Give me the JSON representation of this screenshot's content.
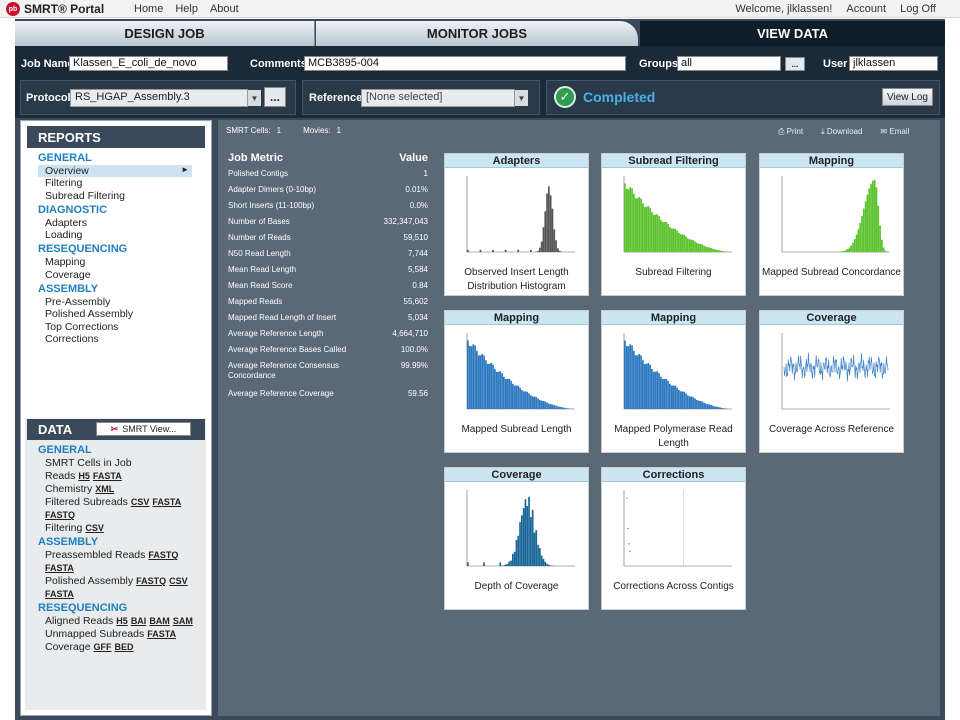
{
  "topbar": {
    "logo_mark": "pb",
    "logo_text": "SMRT® Portal",
    "nav": [
      "Home",
      "Help",
      "About"
    ],
    "welcome": "Welcome, jlklassen!",
    "account": "Account",
    "logoff": "Log Off"
  },
  "tabs": [
    "DESIGN JOB",
    "MONITOR JOBS",
    "VIEW DATA"
  ],
  "job": {
    "name_label": "Job Name",
    "name": "Klassen_E_coli_de_novo",
    "comments_label": "Comments",
    "comments": "MCB3895-004",
    "groups_label": "Groups",
    "groups": "all",
    "groups_btn": "...",
    "user_label": "User",
    "user": "jlklassen",
    "protocol_label": "Protocol",
    "protocol": "RS_HGAP_Assembly.3",
    "protocol_btn": "...",
    "reference_label": "Reference",
    "reference": "[None selected]",
    "status": "Completed",
    "view_log": "View Log"
  },
  "reports": {
    "title": "REPORTS",
    "general": "GENERAL",
    "general_items": [
      "Overview",
      "Filtering",
      "Subread Filtering"
    ],
    "diagnostic": "DIAGNOSTIC",
    "diagnostic_items": [
      "Adapters",
      "Loading"
    ],
    "resequencing": "RESEQUENCING",
    "resequencing_items": [
      "Mapping",
      "Coverage"
    ],
    "assembly": "ASSEMBLY",
    "assembly_items": [
      "Pre-Assembly",
      "Polished Assembly",
      "Top Corrections",
      "Corrections"
    ],
    "selected_marker": "►"
  },
  "data_panel": {
    "title": "DATA",
    "smrt_view": "SMRT View...",
    "general": "GENERAL",
    "cells": "SMRT Cells in Job",
    "reads": "Reads",
    "reads_h5": "H5",
    "reads_fasta": "FASTA",
    "chemistry": "Chemistry",
    "chem_xml": "XML",
    "filtered": "Filtered Subreads",
    "filt_csv": "CSV",
    "filt_fasta": "FASTA",
    "filt_fastq": "FASTQ",
    "filtering": "Filtering",
    "filtering_csv": "CSV",
    "assembly": "ASSEMBLY",
    "preassembled": "Preassembled Reads",
    "pre_fastq": "FASTQ",
    "pre_fasta": "FASTA",
    "polished": "Polished Assembly",
    "pol_fastq": "FASTQ",
    "pol_csv": "CSV",
    "pol_fasta": "FASTA",
    "resequencing": "RESEQUENCING",
    "aligned": "Aligned Reads",
    "al_h5": "H5",
    "al_bai": "BAI",
    "al_bam": "BAM",
    "al_sam": "SAM",
    "unmapped": "Unmapped Subreads",
    "un_fasta": "FASTA",
    "coverage": "Coverage",
    "cov_gff": "GFF",
    "cov_bed": "BED"
  },
  "summary": {
    "cells_label": "SMRT Cells:",
    "cells": "1",
    "movies_label": "Movies:",
    "movies": "1",
    "print": "Print",
    "download": "Download",
    "email": "Email"
  },
  "metrics": {
    "head_metric": "Job Metric",
    "head_value": "Value",
    "rows": [
      {
        "label": "Polished Contigs",
        "value": "1"
      },
      {
        "label": "Adapter Dimers (0-10bp)",
        "value": "0.01%"
      },
      {
        "label": "Short Inserts (11-100bp)",
        "value": "0.0%"
      },
      {
        "label": "Number of Bases",
        "value": "332,347,043"
      },
      {
        "label": "Number of Reads",
        "value": "59,510"
      },
      {
        "label": "N50 Read Length",
        "value": "7,744"
      },
      {
        "label": "Mean Read Length",
        "value": "5,584"
      },
      {
        "label": "Mean Read Score",
        "value": "0.84"
      },
      {
        "label": "Mapped Reads",
        "value": "55,602"
      },
      {
        "label": "Mapped Read Length of Insert",
        "value": "5,034"
      },
      {
        "label": "Average Reference Length",
        "value": "4,664,710"
      },
      {
        "label": "Average Reference Bases Called",
        "value": "100.0%"
      },
      {
        "label": "Average Reference Consensus Concordance",
        "value": "99.99%"
      },
      {
        "label": "Average Reference Coverage",
        "value": "59.56"
      }
    ]
  },
  "cards": [
    {
      "title": "Adapters",
      "caption": "Observed Insert Length Distribution Histogram",
      "color": "#555555",
      "shape": "spike"
    },
    {
      "title": "Subread Filtering",
      "caption": "Subread Filtering",
      "color": "#5cc22e",
      "shape": "decay"
    },
    {
      "title": "Mapping",
      "caption": "Mapped Subread Concordance",
      "color": "#5cc22e",
      "shape": "ramp"
    },
    {
      "title": "Mapping",
      "caption": "Mapped Subread Length",
      "color": "#2f79c0",
      "shape": "decay"
    },
    {
      "title": "Mapping",
      "caption": "Mapped Polymerase Read Length",
      "color": "#2f79c0",
      "shape": "decay"
    },
    {
      "title": "Coverage",
      "caption": "Coverage Across Reference",
      "color": "#3a7fc4",
      "shape": "noise"
    },
    {
      "title": "Coverage",
      "caption": "Depth of Coverage",
      "color": "#1b6898",
      "shape": "bell"
    },
    {
      "title": "Corrections",
      "caption": "Corrections Across Contigs",
      "color": "#4a6fa5",
      "shape": "sparse"
    }
  ]
}
